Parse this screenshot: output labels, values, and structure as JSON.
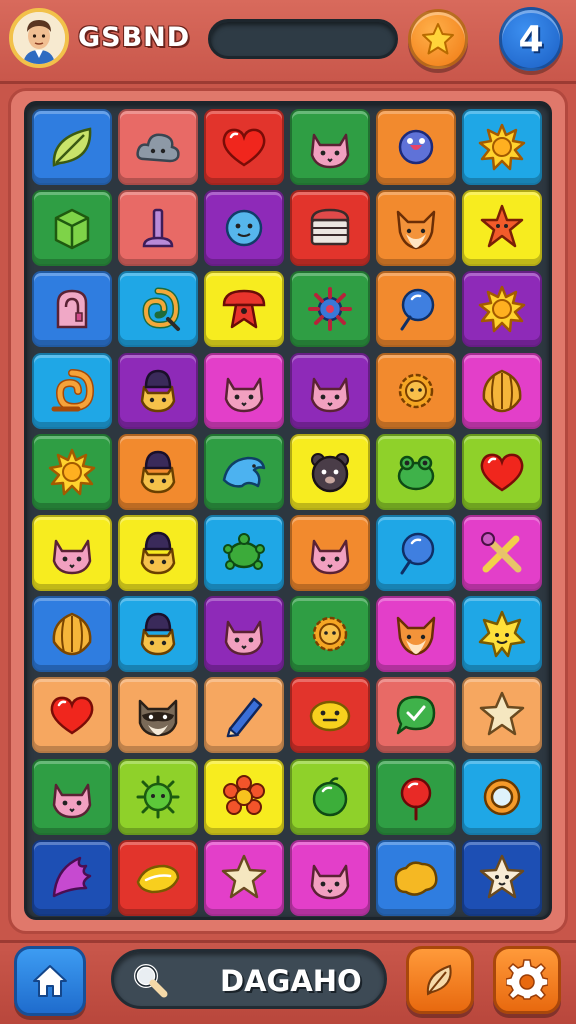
{
  "header": {
    "player_name": "GSBND",
    "level": "4"
  },
  "footer": {
    "search_text": "DAGAHO"
  },
  "colors": {
    "blue": "#2f7de0",
    "salmon": "#e86a66",
    "red": "#e2342c",
    "green": "#2f9e44",
    "orange": "#f28a2e",
    "cyan": "#1fa7e6",
    "yellow": "#f7ec1f",
    "purple": "#8e2ab8",
    "magenta": "#e33fc9",
    "lime": "#8fd12a",
    "peach": "#f6a760",
    "navy": "#1d4fb4"
  },
  "board": {
    "rows": [
      [
        {
          "color": "blue",
          "icon": "leaf-icon"
        },
        {
          "color": "salmon",
          "icon": "cloud-icon"
        },
        {
          "color": "red",
          "icon": "heart-icon"
        },
        {
          "color": "green",
          "icon": "cat-face-icon"
        },
        {
          "color": "orange",
          "icon": "bubble-creature-icon"
        },
        {
          "color": "cyan",
          "icon": "sun-icon"
        }
      ],
      [
        {
          "color": "green",
          "icon": "cube-icon"
        },
        {
          "color": "salmon",
          "icon": "candle-icon"
        },
        {
          "color": "purple",
          "icon": "ball-face-icon"
        },
        {
          "color": "red",
          "icon": "treasure-box-icon"
        },
        {
          "color": "orange",
          "icon": "fox-icon"
        },
        {
          "color": "yellow",
          "icon": "starfish-icon"
        }
      ],
      [
        {
          "color": "blue",
          "icon": "locker-icon"
        },
        {
          "color": "cyan",
          "icon": "spiral-icon"
        },
        {
          "color": "yellow",
          "icon": "mushroom-icon"
        },
        {
          "color": "green",
          "icon": "bug-icon"
        },
        {
          "color": "orange",
          "icon": "balloon-icon"
        },
        {
          "color": "purple",
          "icon": "sun-icon"
        }
      ],
      [
        {
          "color": "cyan",
          "icon": "snail-icon"
        },
        {
          "color": "purple",
          "icon": "hat-cat-icon"
        },
        {
          "color": "magenta",
          "icon": "cat-face-icon"
        },
        {
          "color": "purple",
          "icon": "cat-face-icon"
        },
        {
          "color": "orange",
          "icon": "gear-sun-icon"
        },
        {
          "color": "magenta",
          "icon": "shell-icon"
        }
      ],
      [
        {
          "color": "green",
          "icon": "sun-icon"
        },
        {
          "color": "orange",
          "icon": "hat-cat-icon"
        },
        {
          "color": "green",
          "icon": "dolphin-icon"
        },
        {
          "color": "yellow",
          "icon": "bear-face-icon"
        },
        {
          "color": "lime",
          "icon": "frog-icon"
        },
        {
          "color": "lime",
          "icon": "heart-icon"
        }
      ],
      [
        {
          "color": "yellow",
          "icon": "cat-face-icon"
        },
        {
          "color": "yellow",
          "icon": "hat-cat-icon"
        },
        {
          "color": "cyan",
          "icon": "turtle-icon"
        },
        {
          "color": "orange",
          "icon": "cat-face-icon"
        },
        {
          "color": "cyan",
          "icon": "balloon-icon"
        },
        {
          "color": "magenta",
          "icon": "crossed-tools-icon"
        }
      ],
      [
        {
          "color": "blue",
          "icon": "shell-icon"
        },
        {
          "color": "cyan",
          "icon": "hat-cat-icon"
        },
        {
          "color": "purple",
          "icon": "cat-face-icon"
        },
        {
          "color": "green",
          "icon": "gear-sun-icon"
        },
        {
          "color": "magenta",
          "icon": "fox-icon"
        },
        {
          "color": "cyan",
          "icon": "sun-face-icon"
        }
      ],
      [
        {
          "color": "peach",
          "icon": "heart-icon"
        },
        {
          "color": "peach",
          "icon": "raccoon-icon"
        },
        {
          "color": "peach",
          "icon": "pencil-icon"
        },
        {
          "color": "red",
          "icon": "lemon-face-icon"
        },
        {
          "color": "salmon",
          "icon": "chat-bubble-icon"
        },
        {
          "color": "peach",
          "icon": "star-icon"
        }
      ],
      [
        {
          "color": "green",
          "icon": "cat-face-icon"
        },
        {
          "color": "lime",
          "icon": "germ-icon"
        },
        {
          "color": "yellow",
          "icon": "flower-icon"
        },
        {
          "color": "lime",
          "icon": "ball-icon"
        },
        {
          "color": "green",
          "icon": "pin-icon"
        },
        {
          "color": "cyan",
          "icon": "ring-icon"
        }
      ],
      [
        {
          "color": "navy",
          "icon": "feather-icon"
        },
        {
          "color": "red",
          "icon": "lemon-icon"
        },
        {
          "color": "magenta",
          "icon": "star-icon"
        },
        {
          "color": "magenta",
          "icon": "cat-face-icon"
        },
        {
          "color": "blue",
          "icon": "nugget-icon"
        },
        {
          "color": "navy",
          "icon": "star-face-icon"
        }
      ]
    ]
  }
}
